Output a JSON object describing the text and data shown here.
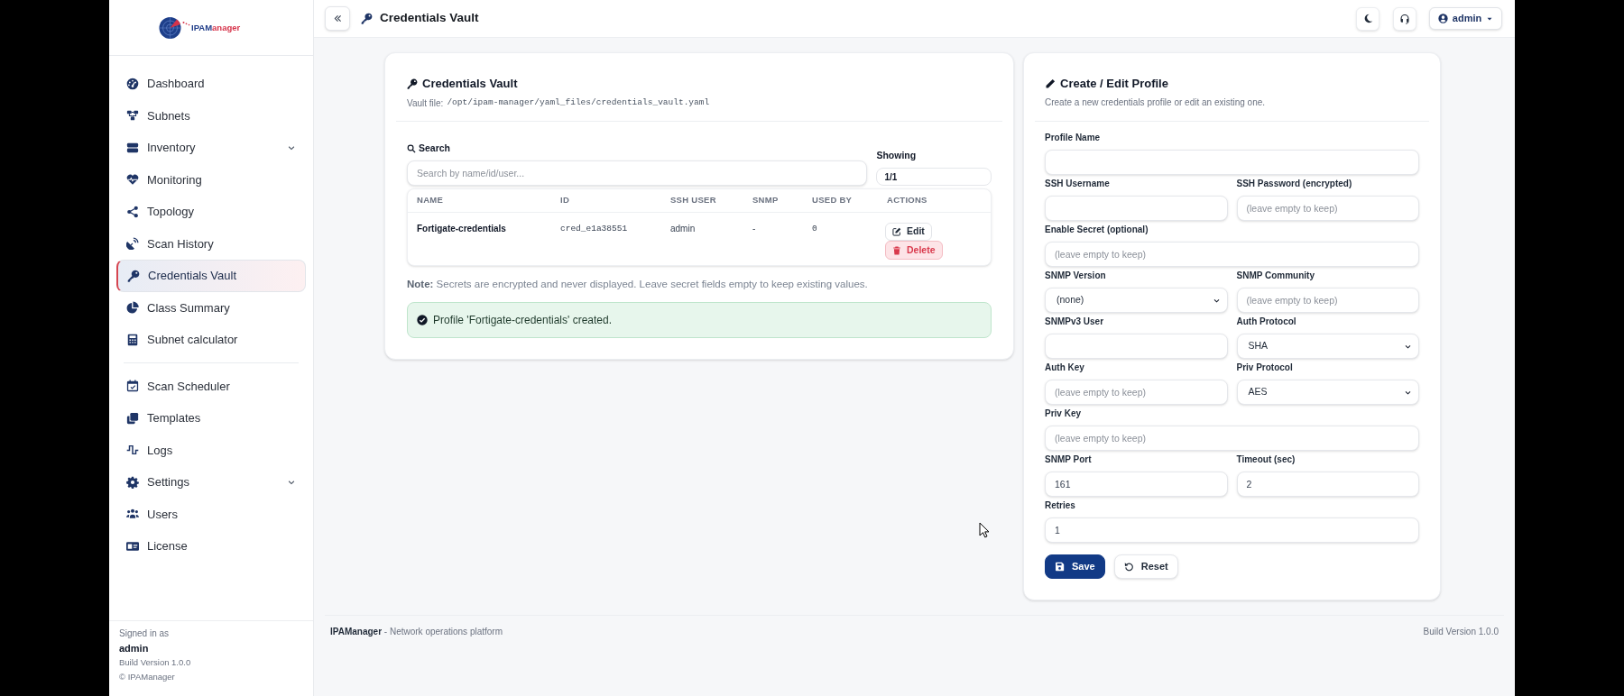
{
  "logo": {
    "primary": "IPAM",
    "accent": "anager"
  },
  "sidebar": {
    "sections": [
      {
        "items": [
          {
            "label": "Dashboard",
            "selected": false,
            "expandable": false
          },
          {
            "label": "Subnets",
            "selected": false,
            "expandable": false
          },
          {
            "label": "Inventory",
            "selected": false,
            "expandable": true
          },
          {
            "label": "Monitoring",
            "selected": false,
            "expandable": false
          },
          {
            "label": "Topology",
            "selected": false,
            "expandable": false
          },
          {
            "label": "Scan History",
            "selected": false,
            "expandable": false
          },
          {
            "label": "Credentials Vault",
            "selected": true,
            "expandable": false
          },
          {
            "label": "Class Summary",
            "selected": false,
            "expandable": false
          },
          {
            "label": "Subnet calculator",
            "selected": false,
            "expandable": false
          }
        ]
      },
      {
        "items": [
          {
            "label": "Scan Scheduler",
            "selected": false,
            "expandable": false
          },
          {
            "label": "Templates",
            "selected": false,
            "expandable": false
          },
          {
            "label": "Logs",
            "selected": false,
            "expandable": false
          },
          {
            "label": "Settings",
            "selected": false,
            "expandable": true
          },
          {
            "label": "Users",
            "selected": false,
            "expandable": false
          },
          {
            "label": "License",
            "selected": false,
            "expandable": false
          }
        ]
      }
    ],
    "footer": {
      "signed_in_label": "Signed in as",
      "user": "admin",
      "build": "Build Version 1.0.0",
      "copyright": "© IPAManager"
    }
  },
  "topbar": {
    "title": "Credentials Vault",
    "user": "admin"
  },
  "vault_card": {
    "title": "Credentials Vault",
    "vault_file_label": "Vault file:",
    "vault_file_path": "/opt/ipam-manager/yaml_files/credentials_vault.yaml",
    "search": {
      "label": "Search",
      "placeholder": "Search by name/id/user..."
    },
    "showing": {
      "label": "Showing",
      "value": "1/1"
    },
    "table": {
      "columns": [
        "NAME",
        "ID",
        "SSH USER",
        "SNMP",
        "USED BY",
        "ACTIONS"
      ],
      "rows": [
        {
          "cells": [
            "Fortigate-credentials",
            "cred_e1a38551",
            "admin",
            "-",
            "0"
          ],
          "actions": [
            {
              "kind": "edit",
              "label": "Edit"
            },
            {
              "kind": "delete",
              "label": "Delete"
            }
          ]
        }
      ]
    },
    "note": "**Note:** Secrets are encrypted and never displayed. Leave secret fields empty to keep existing values.",
    "alert": {
      "kind": "success",
      "text": "Profile 'Fortigate-credentials' created."
    }
  },
  "profile_card": {
    "title": "Create / Edit Profile",
    "subtitle": "Create a new credentials profile or edit an existing one.",
    "rows": [
      {
        "fields": [
          {
            "label": "Profile Name",
            "kind": "text"
          }
        ]
      },
      {
        "fields": [
          {
            "label": "SSH Username",
            "kind": "text"
          },
          {
            "label": "SSH Password (encrypted)",
            "kind": "text",
            "placeholder": "(leave empty to keep)"
          }
        ]
      },
      {
        "fields": [
          {
            "label": "Enable Secret (optional)",
            "kind": "text",
            "placeholder": "(leave empty to keep)"
          }
        ]
      },
      {
        "fields": [
          {
            "label": "SNMP Version",
            "kind": "select",
            "value": "(none)"
          },
          {
            "label": "SNMP Community",
            "kind": "text",
            "placeholder": "(leave empty to keep)"
          }
        ]
      },
      {
        "fields": [
          {
            "label": "SNMPv3 User",
            "kind": "text"
          },
          {
            "label": "Auth Protocol",
            "kind": "select",
            "value": "SHA"
          }
        ]
      },
      {
        "fields": [
          {
            "label": "Auth Key",
            "kind": "text",
            "placeholder": "(leave empty to keep)"
          },
          {
            "label": "Priv Protocol",
            "kind": "select",
            "value": "AES"
          }
        ]
      },
      {
        "fields": [
          {
            "label": "Priv Key",
            "kind": "text",
            "placeholder": "(leave empty to keep)"
          }
        ]
      },
      {
        "fields": [
          {
            "label": "SNMP Port",
            "kind": "text",
            "value": "161"
          },
          {
            "label": "Timeout (sec)",
            "kind": "text",
            "value": "2"
          }
        ]
      },
      {
        "fields": [
          {
            "label": "Retries",
            "kind": "text",
            "value": "1"
          }
        ]
      }
    ],
    "buttons": [
      {
        "kind": "primary",
        "label": "Save"
      },
      {
        "kind": "secondary",
        "label": "Reset"
      }
    ]
  },
  "footer": {
    "brand_text": "**IPAManager** - Network operations platform",
    "build": "Build Version 1.0.0"
  }
}
